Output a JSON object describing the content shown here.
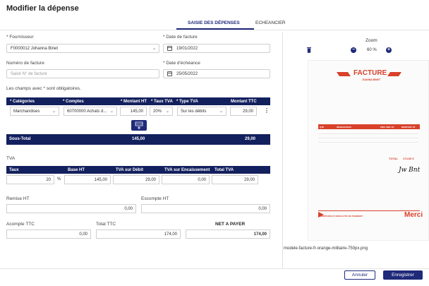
{
  "page": {
    "title": "Modifier la dépense"
  },
  "tabs": [
    {
      "label": "SAISIE DES DÉPENSES",
      "active": true
    },
    {
      "label": "ECHEANCIER",
      "active": false
    }
  ],
  "form": {
    "supplier": {
      "label": "* Fournisseur",
      "value": "F0000012 Johanna Binet"
    },
    "invoice_date": {
      "label": "* Date de facture",
      "value": "19/01/2022"
    },
    "invoice_number": {
      "label": "Numéro de facture",
      "placeholder": "Saisir N° de facture"
    },
    "due_date": {
      "label": "* Date d'échéance",
      "value": "25/05/2022"
    },
    "required_note": "Les champs avec * sont obligatoires."
  },
  "lines_table": {
    "headers": [
      "* Catégories",
      "* Comptes",
      "* Montant HT",
      "* Taux TVA",
      "* Type TVA",
      "Montant TTC"
    ],
    "row": {
      "category": "Marchandises",
      "account": "60700000 Achats d...",
      "amount_ht": "145,00",
      "vat_rate": "20%",
      "vat_type": "Sur les débits",
      "amount_ttc": "29,00"
    },
    "subtotal": {
      "label": "Sous-Total",
      "ht": "145,00",
      "ttc": "29,00"
    }
  },
  "vat": {
    "title": "TVA",
    "headers": [
      "Taux",
      "Base HT",
      "TVA sur Débit",
      "TVA sur Encaissement",
      "Total TVA"
    ],
    "row": {
      "rate": "20",
      "rate_unit": "%",
      "base": "145,00",
      "debit": "29,00",
      "encaissement": "0,00",
      "total": "29,00"
    }
  },
  "totals": {
    "remise_label": "Remise HT",
    "remise_value": "0,00",
    "escompte_label": "Escompte HT",
    "escompte_value": "0,00",
    "acompte_label": "Acompte TTC",
    "acompte_value": "0,00",
    "total_ttc_label": "Total TTC",
    "total_ttc_value": "174,00",
    "net_label": "NET A PAYER",
    "net_value": "174,00"
  },
  "preview": {
    "zoom_label": "Zoom",
    "zoom_value": "60 %",
    "filename": "modele-facture-fr-orange-militaire-750px.png",
    "invoice": {
      "title": "FACTURE",
      "name": "JOANNA BINET",
      "total_label": "TOTAL",
      "total_value": "174,00 €",
      "merci": "Merci",
      "conditions": "CONDITIONS ET MODALITÉS DE PAIEMENT",
      "col_headers": [
        "QTÉ",
        "DÉSIGNATION",
        "PRIX UNIT HT",
        "MONTANT HT"
      ]
    }
  },
  "footer": {
    "cancel": "Annuler",
    "save": "Enregistrer"
  },
  "colors": {
    "navy": "#13205e",
    "accent": "#1f2a7a",
    "invoice_red": "#d8412a"
  }
}
